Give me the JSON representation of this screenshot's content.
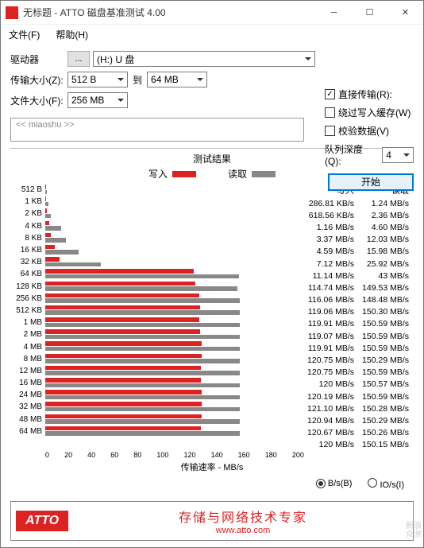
{
  "window": {
    "title": "无标题 - ATTO 磁盘基准测试 4.00"
  },
  "menu": {
    "file": "文件(F)",
    "help": "帮助(H)"
  },
  "form": {
    "drive_label": "驱动器",
    "browse": "...",
    "drive_value": "(H:) U 盘",
    "transfer_label": "传输大小(Z):",
    "transfer_from": "512 B",
    "transfer_to_label": "到",
    "transfer_to": "64 MB",
    "file_label": "文件大小(F):",
    "file_value": "256 MB"
  },
  "options": {
    "direct": "直接传输(R):",
    "bypass": "绕过写入缓存(W)",
    "verify": "校验数据(V)",
    "queue_label": "队列深度(Q):",
    "queue_value": "4",
    "start": "开始"
  },
  "status": "<< miaoshu >>",
  "results": {
    "title": "测试结果",
    "legend_write": "写入",
    "legend_read": "读取",
    "header_write": "写入",
    "header_read": "读取",
    "x_axis_label": "传输速率 - MB/s",
    "rows": [
      {
        "label": "512 B",
        "write": "286.81 KB/s",
        "read": "1.24 MB/s",
        "wv": 0.286,
        "rv": 1.24
      },
      {
        "label": "1 KB",
        "write": "618.56 KB/s",
        "read": "2.36 MB/s",
        "wv": 0.618,
        "rv": 2.36
      },
      {
        "label": "2 KB",
        "write": "1.16 MB/s",
        "read": "4.60 MB/s",
        "wv": 1.16,
        "rv": 4.6
      },
      {
        "label": "4 KB",
        "write": "3.37 MB/s",
        "read": "12.03 MB/s",
        "wv": 3.37,
        "rv": 12.03
      },
      {
        "label": "8 KB",
        "write": "4.59 MB/s",
        "read": "15.98 MB/s",
        "wv": 4.59,
        "rv": 15.98
      },
      {
        "label": "16 KB",
        "write": "7.12 MB/s",
        "read": "25.92 MB/s",
        "wv": 7.12,
        "rv": 25.92
      },
      {
        "label": "32 KB",
        "write": "11.14 MB/s",
        "read": "43 MB/s",
        "wv": 11.14,
        "rv": 43
      },
      {
        "label": "64 KB",
        "write": "114.74 MB/s",
        "read": "149.53 MB/s",
        "wv": 114.74,
        "rv": 149.53
      },
      {
        "label": "128 KB",
        "write": "116.06 MB/s",
        "read": "148.48 MB/s",
        "wv": 116.06,
        "rv": 148.48
      },
      {
        "label": "256 KB",
        "write": "119.06 MB/s",
        "read": "150.30 MB/s",
        "wv": 119.06,
        "rv": 150.3
      },
      {
        "label": "512 KB",
        "write": "119.91 MB/s",
        "read": "150.59 MB/s",
        "wv": 119.91,
        "rv": 150.59
      },
      {
        "label": "1 MB",
        "write": "119.07 MB/s",
        "read": "150.59 MB/s",
        "wv": 119.07,
        "rv": 150.59
      },
      {
        "label": "2 MB",
        "write": "119.91 MB/s",
        "read": "150.59 MB/s",
        "wv": 119.91,
        "rv": 150.59
      },
      {
        "label": "4 MB",
        "write": "120.75 MB/s",
        "read": "150.29 MB/s",
        "wv": 120.75,
        "rv": 150.29
      },
      {
        "label": "8 MB",
        "write": "120.75 MB/s",
        "read": "150.59 MB/s",
        "wv": 120.75,
        "rv": 150.59
      },
      {
        "label": "12 MB",
        "write": "120 MB/s",
        "read": "150.57 MB/s",
        "wv": 120,
        "rv": 150.57
      },
      {
        "label": "16 MB",
        "write": "120.19 MB/s",
        "read": "150.59 MB/s",
        "wv": 120.19,
        "rv": 150.59
      },
      {
        "label": "24 MB",
        "write": "121.10 MB/s",
        "read": "150.28 MB/s",
        "wv": 121.1,
        "rv": 150.28
      },
      {
        "label": "32 MB",
        "write": "120.94 MB/s",
        "read": "150.29 MB/s",
        "wv": 120.94,
        "rv": 150.29
      },
      {
        "label": "48 MB",
        "write": "120.67 MB/s",
        "read": "150.26 MB/s",
        "wv": 120.67,
        "rv": 150.26
      },
      {
        "label": "64 MB",
        "write": "120 MB/s",
        "read": "150.15 MB/s",
        "wv": 120,
        "rv": 150.15
      }
    ],
    "x_ticks": [
      "0",
      "20",
      "40",
      "60",
      "80",
      "100",
      "120",
      "140",
      "160",
      "180",
      "200"
    ],
    "x_max": 200
  },
  "radio": {
    "bps": "B/s(B)",
    "iops": "IO/s(I)"
  },
  "footer": {
    "logo": "ATTO",
    "title": "存储与网络技术专家",
    "url": "www.atto.com"
  },
  "watermark": {
    "l1": "新浪",
    "l2": "众测"
  },
  "chart_data": {
    "type": "bar",
    "title": "测试结果",
    "xlabel": "传输速率 - MB/s",
    "xlim": [
      0,
      200
    ],
    "categories": [
      "512 B",
      "1 KB",
      "2 KB",
      "4 KB",
      "8 KB",
      "16 KB",
      "32 KB",
      "64 KB",
      "128 KB",
      "256 KB",
      "512 KB",
      "1 MB",
      "2 MB",
      "4 MB",
      "8 MB",
      "12 MB",
      "16 MB",
      "24 MB",
      "32 MB",
      "48 MB",
      "64 MB"
    ],
    "series": [
      {
        "name": "写入",
        "color": "#d22",
        "values": [
          0.286,
          0.618,
          1.16,
          3.37,
          4.59,
          7.12,
          11.14,
          114.74,
          116.06,
          119.06,
          119.91,
          119.07,
          119.91,
          120.75,
          120.75,
          120,
          120.19,
          121.1,
          120.94,
          120.67,
          120
        ]
      },
      {
        "name": "读取",
        "color": "#888",
        "values": [
          1.24,
          2.36,
          4.6,
          12.03,
          15.98,
          25.92,
          43,
          149.53,
          148.48,
          150.3,
          150.59,
          150.59,
          150.59,
          150.29,
          150.59,
          150.57,
          150.59,
          150.28,
          150.29,
          150.26,
          150.15
        ]
      }
    ]
  }
}
